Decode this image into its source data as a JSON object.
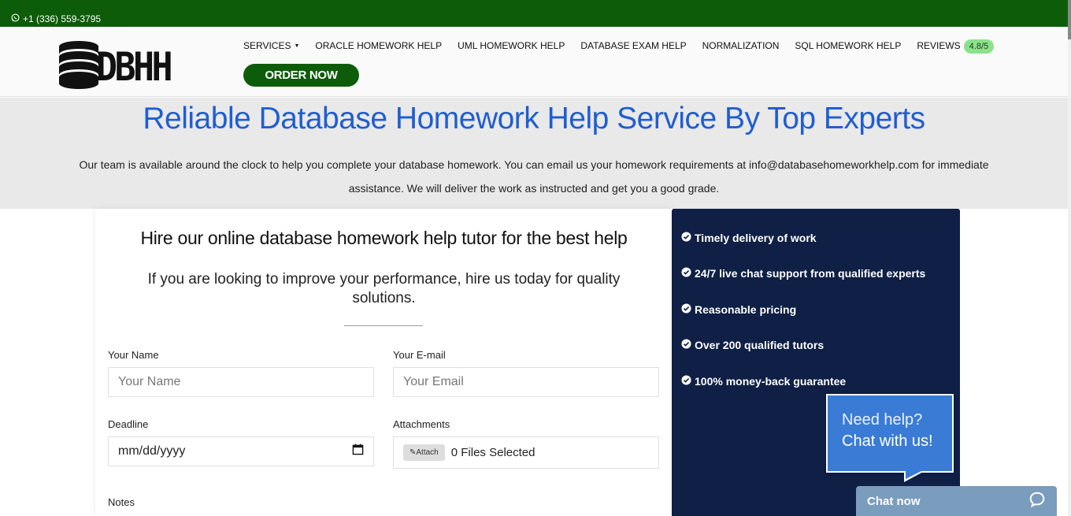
{
  "topbar": {
    "phone": "+1 (336) 559-3795",
    "icon": "whatsapp-icon"
  },
  "logo": {
    "text": "DBHH",
    "icon": "database-stack-icon"
  },
  "nav": {
    "services": "SERVICES",
    "oracle": "ORACLE HOMEWORK HELP",
    "uml": "UML HOMEWORK HELP",
    "database_exam": "DATABASE EXAM HELP",
    "normalization": "NORMALIZATION",
    "sql": "SQL HOMEWORK HELP",
    "reviews": "REVIEWS",
    "rating": "4.8/5",
    "order_now": "ORDER NOW"
  },
  "hero": {
    "title": "Reliable Database Homework Help Service By Top Experts",
    "description": "Our team is available around the clock to help you complete your database homework. You can email us your homework requirements at info@databasehomeworkhelp.com for immediate assistance. We will deliver the work as instructed and get you a good grade."
  },
  "form": {
    "heading": "Hire our online database homework help tutor for the best help",
    "subheading": "If you are looking to improve your performance, hire us today for quality solutions.",
    "name_label": "Your Name",
    "name_placeholder": "Your Name",
    "email_label": "Your E-mail",
    "email_placeholder": "Your Email",
    "deadline_label": "Deadline",
    "deadline_value": "mm/dd/yyyy",
    "attachments_label": "Attachments",
    "attach_button": "Attach",
    "files_status": "0 Files Selected",
    "notes_label": "Notes"
  },
  "benefits": [
    "Timely delivery of work",
    "24/7 live chat support from qualified experts",
    "Reasonable pricing",
    "Over 200 qualified tutors",
    "100% money-back guarantee"
  ],
  "chat": {
    "line1": "Need help?",
    "line2": "Chat with us!",
    "chat_now": "Chat now"
  },
  "colors": {
    "brand_green": "#0d5c09",
    "title_blue": "#1f5ed1",
    "panel_navy": "#0f1f45",
    "chat_blue": "#3a7bd5"
  }
}
